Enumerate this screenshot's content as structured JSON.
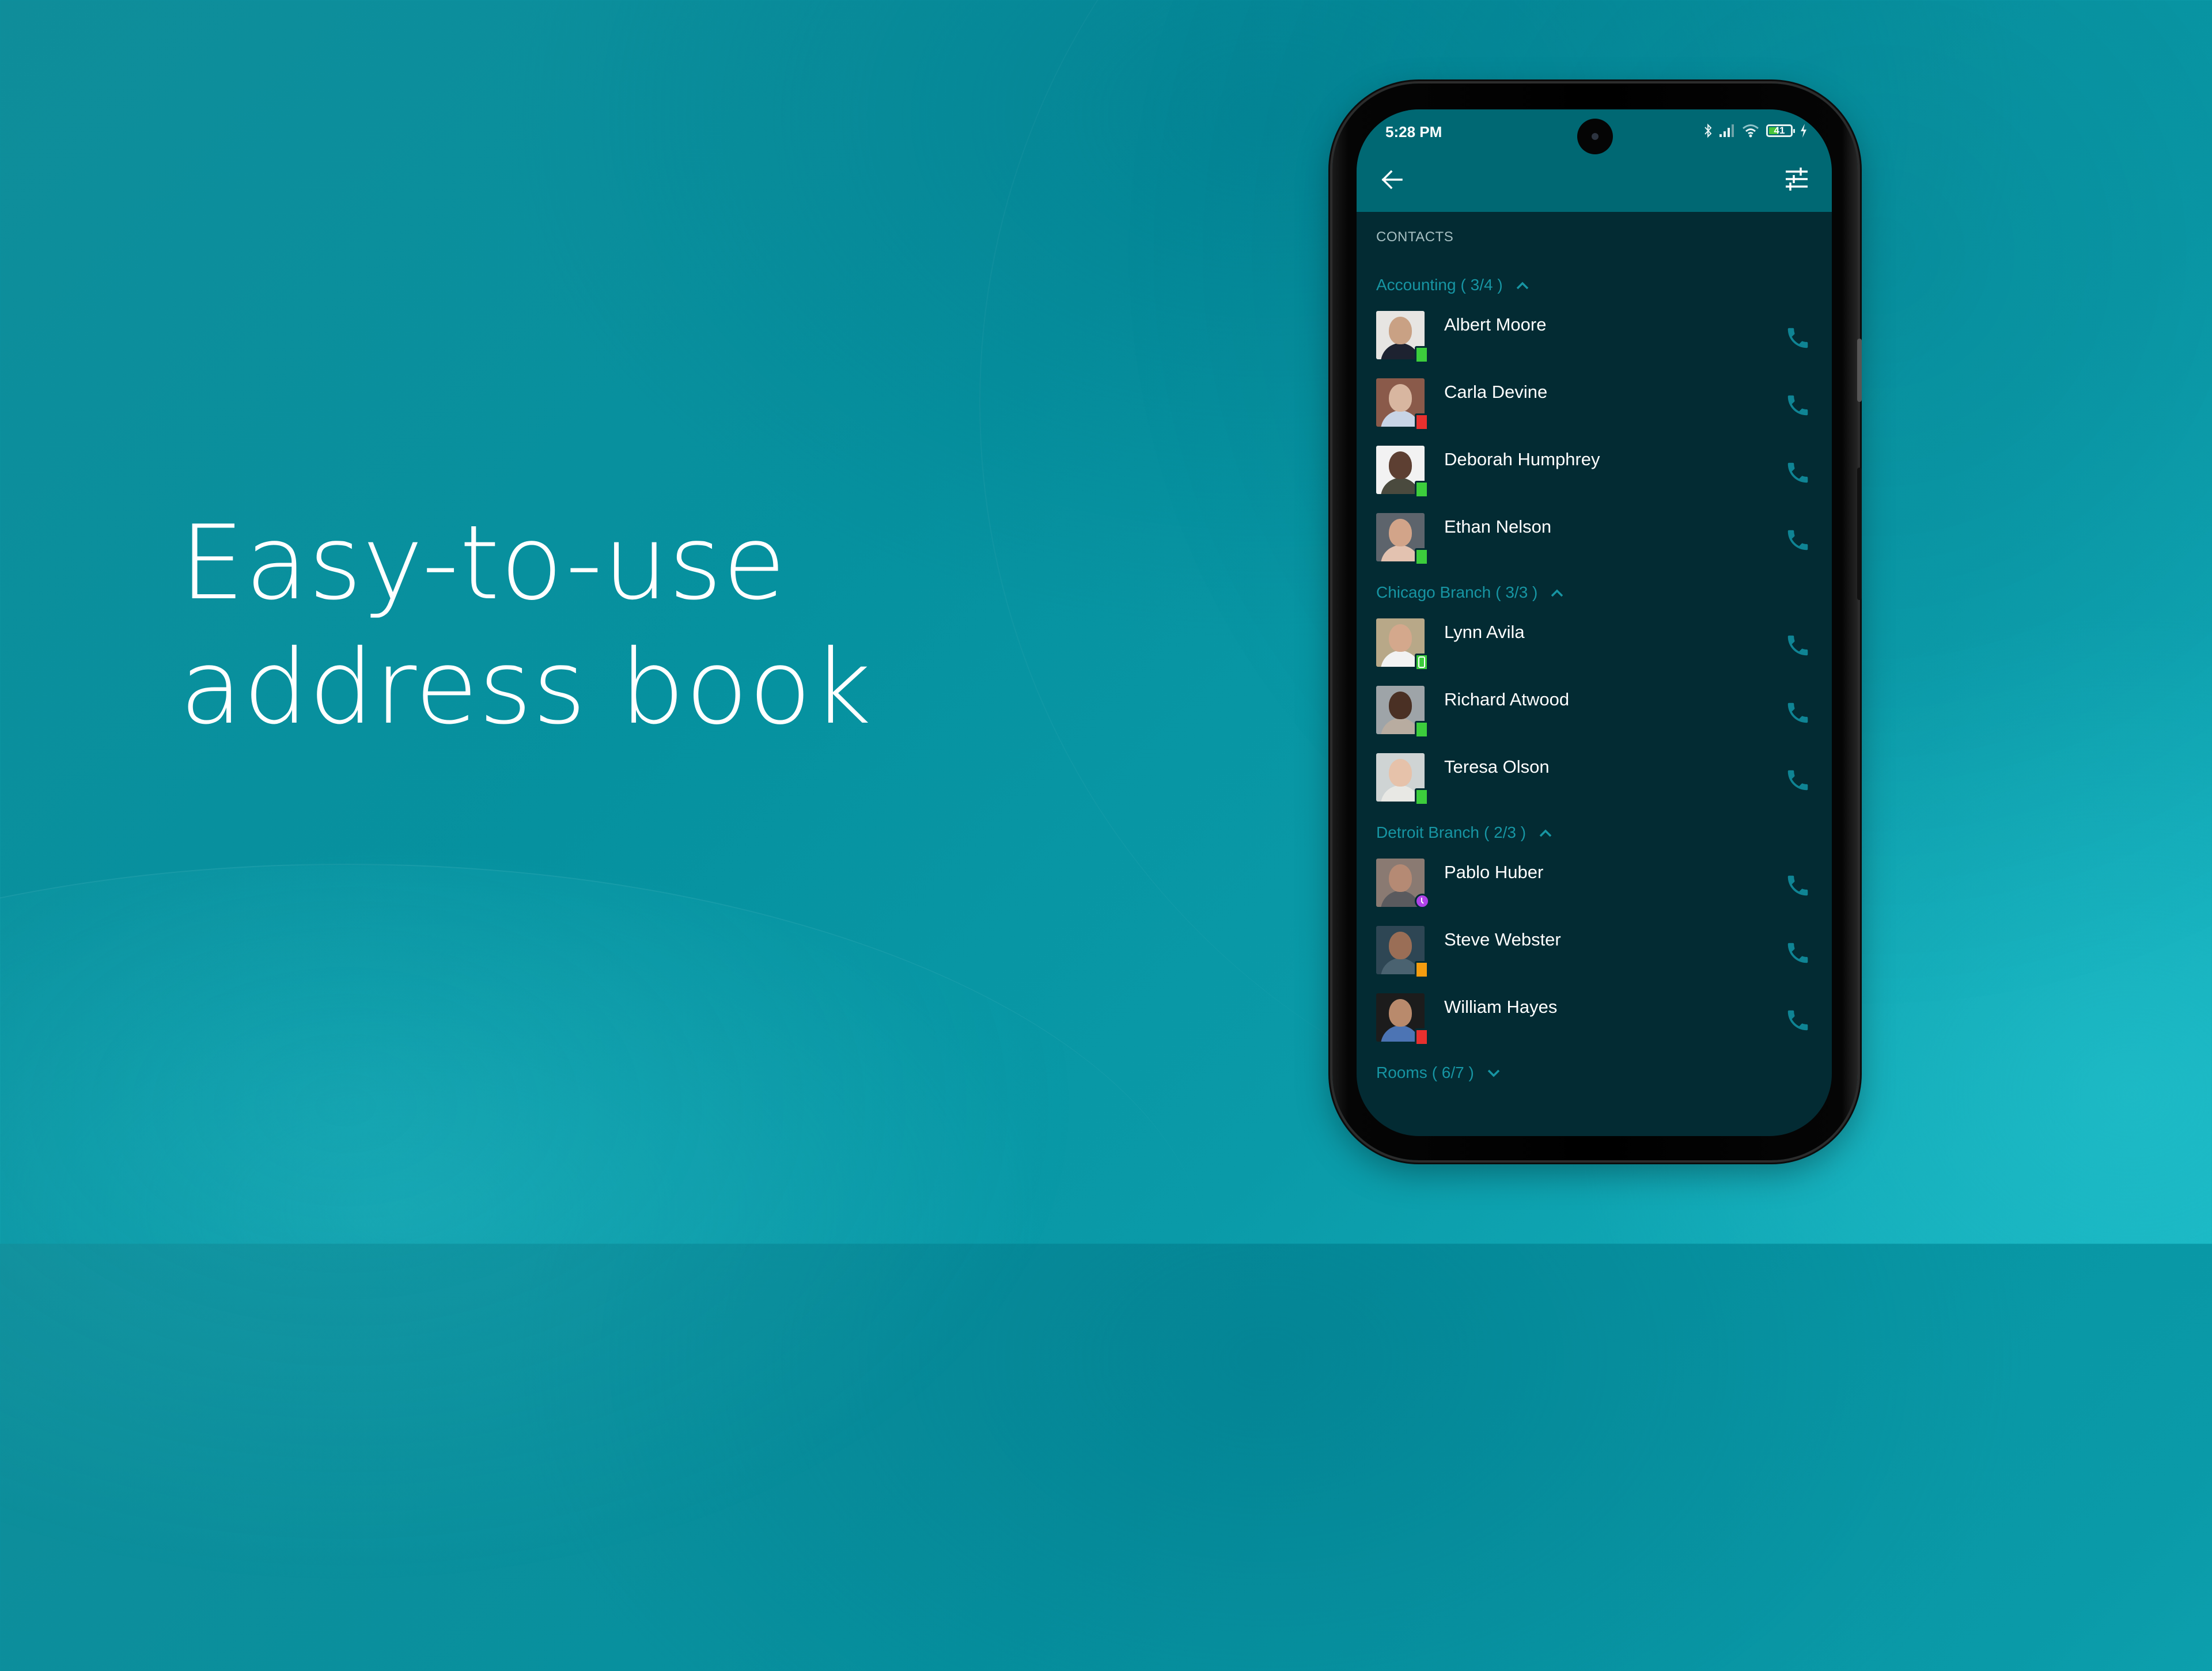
{
  "headline": {
    "line1": "Easy-to-use",
    "line2": "address book"
  },
  "status_bar": {
    "time": "5:28 PM",
    "battery_level": "41",
    "icons": [
      "bluetooth-icon",
      "signal-icon",
      "wifi-icon",
      "battery-icon",
      "charging-icon"
    ]
  },
  "app_bar": {
    "back_icon": "arrow-left-icon",
    "filter_icon": "sliders-icon"
  },
  "section_title": "CONTACTS",
  "colors": {
    "accent": "#1795a3",
    "app_bar": "#006873",
    "list_bg": "#032b33",
    "status_available": "#3ccd3c",
    "status_busy": "#e8302e",
    "status_away": "#f59c0f",
    "status_scheduled": "#b042e8"
  },
  "groups": [
    {
      "name": "Accounting",
      "count": "( 3/4 )",
      "expanded": true,
      "contacts": [
        {
          "name": "Albert Moore",
          "status": "available",
          "status_icon": "square",
          "skin": "#c9a184",
          "shirt": "#1d2230",
          "bg": "#e7e5e2"
        },
        {
          "name": "Carla Devine",
          "status": "busy",
          "status_icon": "square",
          "skin": "#d8b6a0",
          "shirt": "#c8d4e6",
          "bg": "#8a5a4a"
        },
        {
          "name": "Deborah Humphrey",
          "status": "available",
          "status_icon": "square",
          "skin": "#5d3f32",
          "shirt": "#4a4a3e",
          "bg": "#f2f2f2"
        },
        {
          "name": "Ethan Nelson",
          "status": "available",
          "status_icon": "square",
          "skin": "#d2a489",
          "shirt": "#e3c2b0",
          "bg": "#5d646c"
        }
      ]
    },
    {
      "name": "Chicago Branch",
      "count": "( 3/3 )",
      "expanded": true,
      "contacts": [
        {
          "name": "Lynn Avila",
          "status": "available",
          "status_icon": "mobile",
          "skin": "#d4a88c",
          "shirt": "#f2f2f2",
          "bg": "#b8a888"
        },
        {
          "name": "Richard Atwood",
          "status": "available",
          "status_icon": "square",
          "skin": "#4a3024",
          "shirt": "#b8aca0",
          "bg": "#9ea4a8"
        },
        {
          "name": "Teresa Olson",
          "status": "available",
          "status_icon": "square",
          "skin": "#e6c2aa",
          "shirt": "#e8e8e4",
          "bg": "#cfd4d4"
        }
      ]
    },
    {
      "name": "Detroit Branch",
      "count": "( 2/3 )",
      "expanded": true,
      "contacts": [
        {
          "name": "Pablo Huber",
          "status": "scheduled",
          "status_icon": "clock",
          "skin": "#b58a74",
          "shirt": "#5a5a5e",
          "bg": "#8a7a72"
        },
        {
          "name": "Steve Webster",
          "status": "away",
          "status_icon": "square",
          "skin": "#9a6e56",
          "shirt": "#4a6270",
          "bg": "#2e4654"
        },
        {
          "name": "William Hayes",
          "status": "busy",
          "status_icon": "square",
          "skin": "#b98a6c",
          "shirt": "#4c74b4",
          "bg": "#1c1c1c"
        }
      ]
    },
    {
      "name": "Rooms",
      "count": "( 6/7 )",
      "expanded": false,
      "contacts": []
    }
  ]
}
